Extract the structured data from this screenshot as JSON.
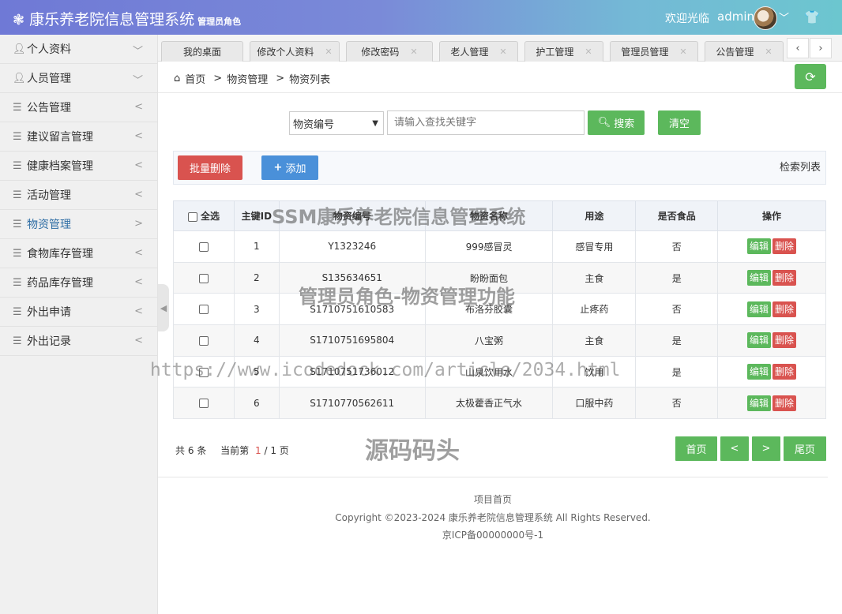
{
  "header": {
    "title": "康乐养老院信息管理系统",
    "role": "管理员角色",
    "welcome": "欢迎光临",
    "username": "admin"
  },
  "sidebar": {
    "items": [
      {
        "label": "个人资料",
        "icon": "user-icon",
        "arrow": "﹀"
      },
      {
        "label": "人员管理",
        "icon": "user-icon",
        "arrow": "﹀"
      },
      {
        "label": "公告管理",
        "icon": "menu-icon",
        "arrow": "<"
      },
      {
        "label": "建议留言管理",
        "icon": "menu-icon",
        "arrow": "<"
      },
      {
        "label": "健康档案管理",
        "icon": "menu-icon",
        "arrow": "<"
      },
      {
        "label": "活动管理",
        "icon": "menu-icon",
        "arrow": "<"
      },
      {
        "label": "物资管理",
        "icon": "menu-icon",
        "arrow": ">"
      },
      {
        "label": "食物库存管理",
        "icon": "menu-icon",
        "arrow": "<"
      },
      {
        "label": "药品库存管理",
        "icon": "menu-icon",
        "arrow": "<"
      },
      {
        "label": "外出申请",
        "icon": "menu-icon",
        "arrow": "<"
      },
      {
        "label": "外出记录",
        "icon": "menu-icon",
        "arrow": "<"
      }
    ]
  },
  "tabs": [
    {
      "label": "我的桌面",
      "closable": false
    },
    {
      "label": "修改个人资料",
      "closable": true
    },
    {
      "label": "修改密码",
      "closable": true
    },
    {
      "label": "老人管理",
      "closable": true
    },
    {
      "label": "护工管理",
      "closable": true
    },
    {
      "label": "管理员管理",
      "closable": true
    },
    {
      "label": "公告管理",
      "closable": true
    }
  ],
  "breadcrumb": {
    "home": "首页",
    "sep": ">",
    "level1": "物资管理",
    "level2": "物资列表"
  },
  "search": {
    "field_selected": "物资编号",
    "placeholder": "请输入查找关键字",
    "search_label": "搜索",
    "clear_label": "清空"
  },
  "toolbar": {
    "batch_delete": "批量删除",
    "add": "添加",
    "search_list": "检索列表"
  },
  "table": {
    "headers": [
      "全选",
      "主键ID",
      "物资编号",
      "物资名称",
      "用途",
      "是否食品",
      "操作"
    ],
    "rows": [
      {
        "id": "1",
        "code": "Y1323246",
        "name": "999感冒灵",
        "use": "感冒专用",
        "food": "否"
      },
      {
        "id": "2",
        "code": "S135634651",
        "name": "盼盼面包",
        "use": "主食",
        "food": "是"
      },
      {
        "id": "3",
        "code": "S1710751610583",
        "name": "布洛芬胶囊",
        "use": "止疼药",
        "food": "否"
      },
      {
        "id": "4",
        "code": "S1710751695804",
        "name": "八宝粥",
        "use": "主食",
        "food": "是"
      },
      {
        "id": "5",
        "code": "S1710751736012",
        "name": "山泉饮用水",
        "use": "饮用",
        "food": "是"
      },
      {
        "id": "6",
        "code": "S1710770562611",
        "name": "太极藿香正气水",
        "use": "口服中药",
        "food": "否"
      }
    ],
    "edit_label": "编辑",
    "delete_label": "删除"
  },
  "pagination": {
    "total_prefix": "共",
    "total": "6",
    "total_suffix": "条",
    "current_prefix": "当前第",
    "current": "1",
    "pages": "/ 1 页",
    "first": "首页",
    "prev": "<",
    "next": ">",
    "last": "尾页"
  },
  "footer": {
    "home": "项目首页",
    "copyright": "Copyright ©2023-2024 康乐养老院信息管理系统 All Rights Reserved.",
    "icp": "京ICP备00000000号-1"
  },
  "watermarks": {
    "line1": "SSM康乐养老院信息管理系统",
    "line2": "管理员角色-物资管理功能",
    "line3": "https://www.icodedock.com/article/2034.html",
    "line4": "源码码头"
  },
  "colors": {
    "green": "#5cb85c",
    "red": "#d9534f",
    "blue": "#4a90d9"
  }
}
